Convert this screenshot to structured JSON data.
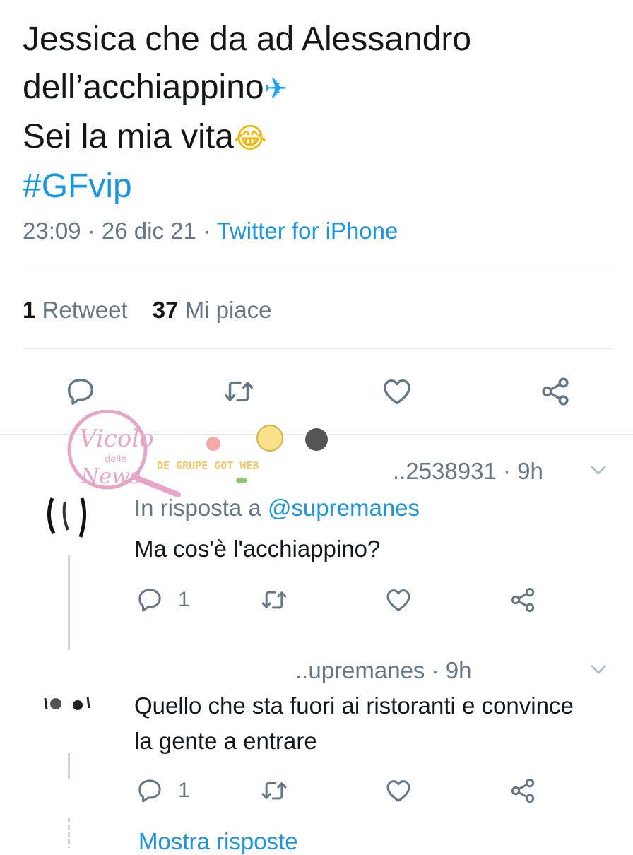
{
  "tweet": {
    "lines": [
      "Jessica che da ad Alessandro",
      "dell’acchiappino",
      "Sei la mia vita"
    ],
    "hashtag": "#GFvip",
    "time": "23:09 · 26 dic 21 · ",
    "source": "Twitter for iPhone",
    "retweets": {
      "count": "1",
      "label": "Retweet"
    },
    "likes": {
      "count": "37",
      "label": "Mi piace"
    },
    "actions": [
      "reply-icon",
      "retweet-icon",
      "like-icon",
      "share-icon"
    ],
    "emojis": [
      "airplane-emoji",
      "laughing-emoji"
    ]
  },
  "watermark": {
    "title": "Vicolo",
    "sub": "delle",
    "title2": "News",
    "tagline": "DE GRUPE GOT WEB"
  },
  "replies": [
    {
      "handle": "..2538931 · 9h",
      "replying_prefix": "In risposta a ",
      "mention": "@supremanes",
      "text": "Ma cos'è l'acchiappino?",
      "reply_count": "1"
    },
    {
      "handle": "..upremanes · 9h",
      "text": "Quello che sta fuori ai ristoranti e convince la gente a entrare",
      "reply_count": "1"
    }
  ],
  "show_more": "Mostra risposte",
  "colors": {
    "accent": "#1b95e0",
    "muted": "#657786",
    "text": "#14171a",
    "border": "#e1e8ed"
  }
}
